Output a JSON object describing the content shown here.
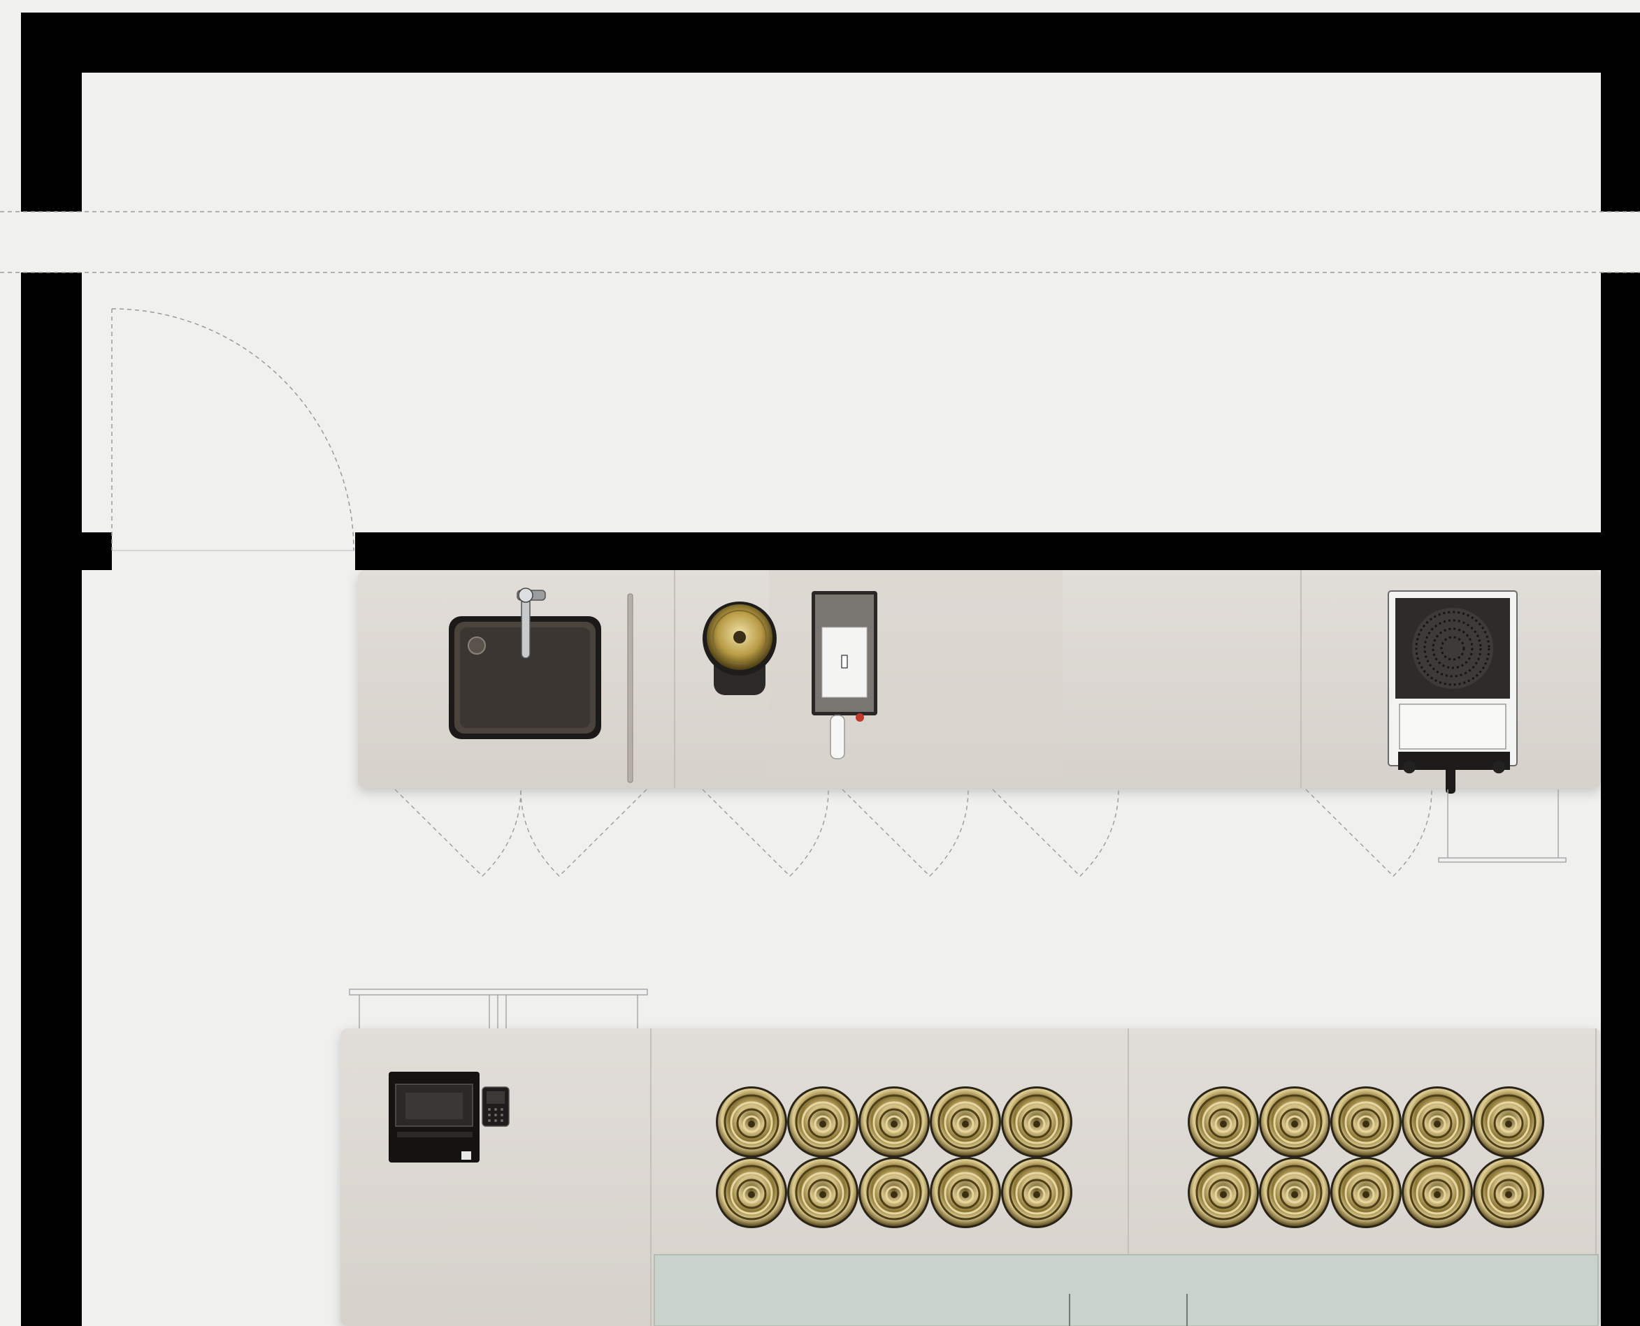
{
  "diagram": {
    "kind": "architectural-floor-plan",
    "view": "top-down",
    "colors": {
      "background": "#f0f0ee",
      "wall": "#000000",
      "counter": "#ddd9d4",
      "counter_edge": "#c9c4be",
      "sink_basin": "#2e2a26",
      "brass": "#b59a52",
      "drawer_glass": "#c8d4cc",
      "dashed_line": "#9a9a9a"
    },
    "back_counter": {
      "fixtures": [
        "sink-basin",
        "mixer-tap",
        "knife-rail",
        "brass-bin",
        "water-boiler",
        "espresso-grinder"
      ]
    },
    "front_counter": {
      "fixtures": [
        "pos-terminal",
        "card-reader",
        "brass-cup-dispensers",
        "glass-drawer-front"
      ]
    },
    "dispenser_groups": [
      {
        "rows": 2,
        "cols": 5
      },
      {
        "rows": 2,
        "cols": 5
      }
    ],
    "icons": [
      "door-swing-icon",
      "cabinet-door-swing-icon",
      "stool-icon"
    ]
  }
}
